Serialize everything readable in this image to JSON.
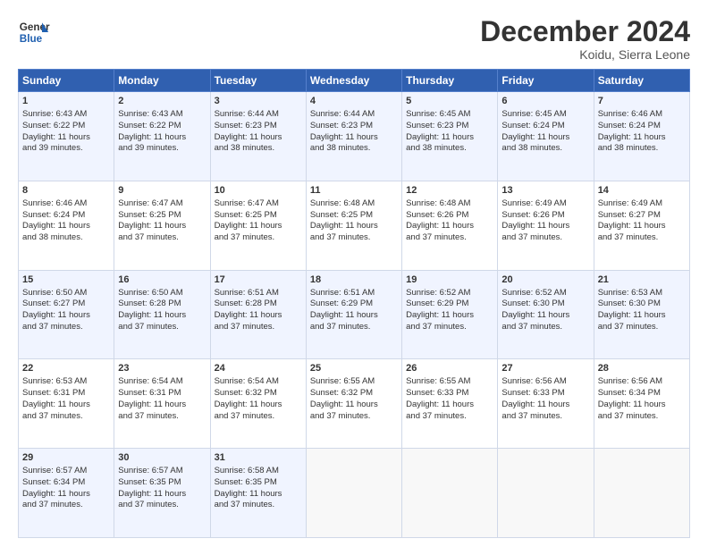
{
  "header": {
    "logo_line1": "General",
    "logo_line2": "Blue",
    "month_title": "December 2024",
    "location": "Koidu, Sierra Leone"
  },
  "days_of_week": [
    "Sunday",
    "Monday",
    "Tuesday",
    "Wednesday",
    "Thursday",
    "Friday",
    "Saturday"
  ],
  "weeks": [
    [
      {
        "day": "1",
        "lines": [
          "Sunrise: 6:43 AM",
          "Sunset: 6:22 PM",
          "Daylight: 11 hours",
          "and 39 minutes."
        ]
      },
      {
        "day": "2",
        "lines": [
          "Sunrise: 6:43 AM",
          "Sunset: 6:22 PM",
          "Daylight: 11 hours",
          "and 39 minutes."
        ]
      },
      {
        "day": "3",
        "lines": [
          "Sunrise: 6:44 AM",
          "Sunset: 6:23 PM",
          "Daylight: 11 hours",
          "and 38 minutes."
        ]
      },
      {
        "day": "4",
        "lines": [
          "Sunrise: 6:44 AM",
          "Sunset: 6:23 PM",
          "Daylight: 11 hours",
          "and 38 minutes."
        ]
      },
      {
        "day": "5",
        "lines": [
          "Sunrise: 6:45 AM",
          "Sunset: 6:23 PM",
          "Daylight: 11 hours",
          "and 38 minutes."
        ]
      },
      {
        "day": "6",
        "lines": [
          "Sunrise: 6:45 AM",
          "Sunset: 6:24 PM",
          "Daylight: 11 hours",
          "and 38 minutes."
        ]
      },
      {
        "day": "7",
        "lines": [
          "Sunrise: 6:46 AM",
          "Sunset: 6:24 PM",
          "Daylight: 11 hours",
          "and 38 minutes."
        ]
      }
    ],
    [
      {
        "day": "8",
        "lines": [
          "Sunrise: 6:46 AM",
          "Sunset: 6:24 PM",
          "Daylight: 11 hours",
          "and 38 minutes."
        ]
      },
      {
        "day": "9",
        "lines": [
          "Sunrise: 6:47 AM",
          "Sunset: 6:25 PM",
          "Daylight: 11 hours",
          "and 37 minutes."
        ]
      },
      {
        "day": "10",
        "lines": [
          "Sunrise: 6:47 AM",
          "Sunset: 6:25 PM",
          "Daylight: 11 hours",
          "and 37 minutes."
        ]
      },
      {
        "day": "11",
        "lines": [
          "Sunrise: 6:48 AM",
          "Sunset: 6:25 PM",
          "Daylight: 11 hours",
          "and 37 minutes."
        ]
      },
      {
        "day": "12",
        "lines": [
          "Sunrise: 6:48 AM",
          "Sunset: 6:26 PM",
          "Daylight: 11 hours",
          "and 37 minutes."
        ]
      },
      {
        "day": "13",
        "lines": [
          "Sunrise: 6:49 AM",
          "Sunset: 6:26 PM",
          "Daylight: 11 hours",
          "and 37 minutes."
        ]
      },
      {
        "day": "14",
        "lines": [
          "Sunrise: 6:49 AM",
          "Sunset: 6:27 PM",
          "Daylight: 11 hours",
          "and 37 minutes."
        ]
      }
    ],
    [
      {
        "day": "15",
        "lines": [
          "Sunrise: 6:50 AM",
          "Sunset: 6:27 PM",
          "Daylight: 11 hours",
          "and 37 minutes."
        ]
      },
      {
        "day": "16",
        "lines": [
          "Sunrise: 6:50 AM",
          "Sunset: 6:28 PM",
          "Daylight: 11 hours",
          "and 37 minutes."
        ]
      },
      {
        "day": "17",
        "lines": [
          "Sunrise: 6:51 AM",
          "Sunset: 6:28 PM",
          "Daylight: 11 hours",
          "and 37 minutes."
        ]
      },
      {
        "day": "18",
        "lines": [
          "Sunrise: 6:51 AM",
          "Sunset: 6:29 PM",
          "Daylight: 11 hours",
          "and 37 minutes."
        ]
      },
      {
        "day": "19",
        "lines": [
          "Sunrise: 6:52 AM",
          "Sunset: 6:29 PM",
          "Daylight: 11 hours",
          "and 37 minutes."
        ]
      },
      {
        "day": "20",
        "lines": [
          "Sunrise: 6:52 AM",
          "Sunset: 6:30 PM",
          "Daylight: 11 hours",
          "and 37 minutes."
        ]
      },
      {
        "day": "21",
        "lines": [
          "Sunrise: 6:53 AM",
          "Sunset: 6:30 PM",
          "Daylight: 11 hours",
          "and 37 minutes."
        ]
      }
    ],
    [
      {
        "day": "22",
        "lines": [
          "Sunrise: 6:53 AM",
          "Sunset: 6:31 PM",
          "Daylight: 11 hours",
          "and 37 minutes."
        ]
      },
      {
        "day": "23",
        "lines": [
          "Sunrise: 6:54 AM",
          "Sunset: 6:31 PM",
          "Daylight: 11 hours",
          "and 37 minutes."
        ]
      },
      {
        "day": "24",
        "lines": [
          "Sunrise: 6:54 AM",
          "Sunset: 6:32 PM",
          "Daylight: 11 hours",
          "and 37 minutes."
        ]
      },
      {
        "day": "25",
        "lines": [
          "Sunrise: 6:55 AM",
          "Sunset: 6:32 PM",
          "Daylight: 11 hours",
          "and 37 minutes."
        ]
      },
      {
        "day": "26",
        "lines": [
          "Sunrise: 6:55 AM",
          "Sunset: 6:33 PM",
          "Daylight: 11 hours",
          "and 37 minutes."
        ]
      },
      {
        "day": "27",
        "lines": [
          "Sunrise: 6:56 AM",
          "Sunset: 6:33 PM",
          "Daylight: 11 hours",
          "and 37 minutes."
        ]
      },
      {
        "day": "28",
        "lines": [
          "Sunrise: 6:56 AM",
          "Sunset: 6:34 PM",
          "Daylight: 11 hours",
          "and 37 minutes."
        ]
      }
    ],
    [
      {
        "day": "29",
        "lines": [
          "Sunrise: 6:57 AM",
          "Sunset: 6:34 PM",
          "Daylight: 11 hours",
          "and 37 minutes."
        ]
      },
      {
        "day": "30",
        "lines": [
          "Sunrise: 6:57 AM",
          "Sunset: 6:35 PM",
          "Daylight: 11 hours",
          "and 37 minutes."
        ]
      },
      {
        "day": "31",
        "lines": [
          "Sunrise: 6:58 AM",
          "Sunset: 6:35 PM",
          "Daylight: 11 hours",
          "and 37 minutes."
        ]
      },
      {
        "day": "",
        "lines": []
      },
      {
        "day": "",
        "lines": []
      },
      {
        "day": "",
        "lines": []
      },
      {
        "day": "",
        "lines": []
      }
    ]
  ]
}
